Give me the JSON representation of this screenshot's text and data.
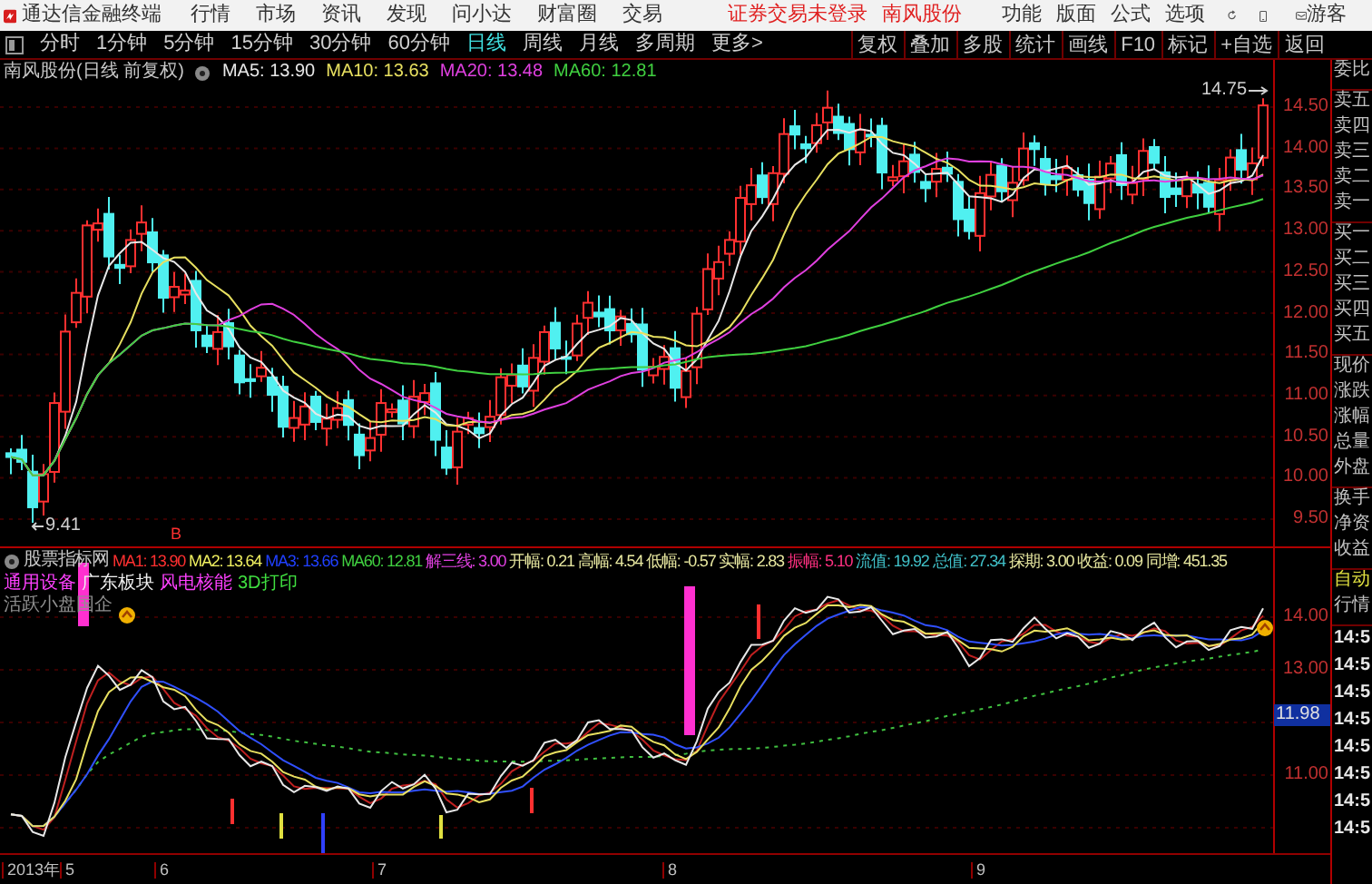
{
  "app": {
    "title": "通达信金融终端",
    "menus": [
      "行情",
      "市场",
      "资讯",
      "发现",
      "问小达",
      "财富圈",
      "交易"
    ],
    "login_status": "证券交易未登录",
    "stock_name": "南风股份",
    "tools": [
      "功能",
      "版面",
      "公式",
      "选项"
    ],
    "user": "游客"
  },
  "periods": [
    {
      "label": "分时",
      "selected": false
    },
    {
      "label": "1分钟",
      "selected": false
    },
    {
      "label": "5分钟",
      "selected": false
    },
    {
      "label": "15分钟",
      "selected": false
    },
    {
      "label": "30分钟",
      "selected": false
    },
    {
      "label": "60分钟",
      "selected": false
    },
    {
      "label": "日线",
      "selected": true
    },
    {
      "label": "周线",
      "selected": false
    },
    {
      "label": "月线",
      "selected": false
    },
    {
      "label": "多周期",
      "selected": false
    },
    {
      "label": "更多>",
      "selected": false
    }
  ],
  "actions": [
    "复权",
    "叠加",
    "多股",
    "统计",
    "画线",
    "F10",
    "标记",
    "+自选",
    "返回"
  ],
  "main_chart": {
    "title": "南风股份(日线 前复权)",
    "ma": [
      {
        "label": "MA5: 13.90",
        "color": "#e8e8e8"
      },
      {
        "label": "MA10: 13.63",
        "color": "#e8e060"
      },
      {
        "label": "MA20: 13.48",
        "color": "#e040e0"
      },
      {
        "label": "MA60: 12.81",
        "color": "#40d040"
      }
    ],
    "high_label": "14.75",
    "low_label": "9.41",
    "buy_mark": "B",
    "price_axis": [
      "14.50",
      "14.00",
      "13.50",
      "13.00",
      "12.50",
      "12.00",
      "11.50",
      "11.00",
      "10.50",
      "10.00",
      "9.50"
    ]
  },
  "indicator": {
    "title": "股票指标网",
    "values": [
      {
        "label": "MA1: 13.90",
        "color": "#ff3030"
      },
      {
        "label": "MA2: 13.64",
        "color": "#f0f060"
      },
      {
        "label": "MA3: 13.66",
        "color": "#2040ff"
      },
      {
        "label": "MA60: 12.81",
        "color": "#40d040"
      },
      {
        "label": "解三线: 3.00",
        "color": "#e040e0"
      },
      {
        "label": "开幅: 0.21",
        "color": "#e8e8a0"
      },
      {
        "label": "高幅: 4.54",
        "color": "#e8e8a0"
      },
      {
        "label": "低幅: -0.57",
        "color": "#e8e8a0"
      },
      {
        "label": "实幅: 2.83",
        "color": "#e8e8a0"
      },
      {
        "label": "振幅: 5.10",
        "color": "#ff3080"
      },
      {
        "label": "流值: 19.92",
        "color": "#40c0c8"
      },
      {
        "label": "总值: 27.34",
        "color": "#40c0c8"
      },
      {
        "label": "探期: 3.00",
        "color": "#e8e8a0"
      },
      {
        "label": "收益: 0.09",
        "color": "#e8e8a0"
      },
      {
        "label": "同增: 451.35",
        "color": "#e8e8a0"
      }
    ],
    "tags": [
      {
        "label": "通用设备",
        "color": "#ff40ff"
      },
      {
        "label": "广东板块",
        "color": "#f0f0f0"
      },
      {
        "label": "风电核能",
        "color": "#ff40ff"
      },
      {
        "label": "3D打印",
        "color": "#40e040"
      }
    ],
    "concept": "活跃小盘国企",
    "value_axis": [
      "14.00",
      "13.00",
      "11.00"
    ],
    "current_badge": "11.98"
  },
  "date_axis": [
    "2013年",
    "5",
    "6",
    "7",
    "8",
    "9"
  ],
  "quote_panel": {
    "labels": [
      "委比",
      "卖五",
      "卖四",
      "卖三",
      "卖二",
      "卖一",
      "买一",
      "买二",
      "买三",
      "买四",
      "买五",
      "现价",
      "涨跌",
      "涨幅",
      "总量",
      "外盘",
      "换手",
      "净资",
      "收益"
    ],
    "mode": [
      "自动",
      "行情"
    ],
    "times": [
      "14:5",
      "14:5",
      "14:5",
      "14:5",
      "14:5",
      "14:5",
      "14:5",
      "14:5"
    ]
  }
}
